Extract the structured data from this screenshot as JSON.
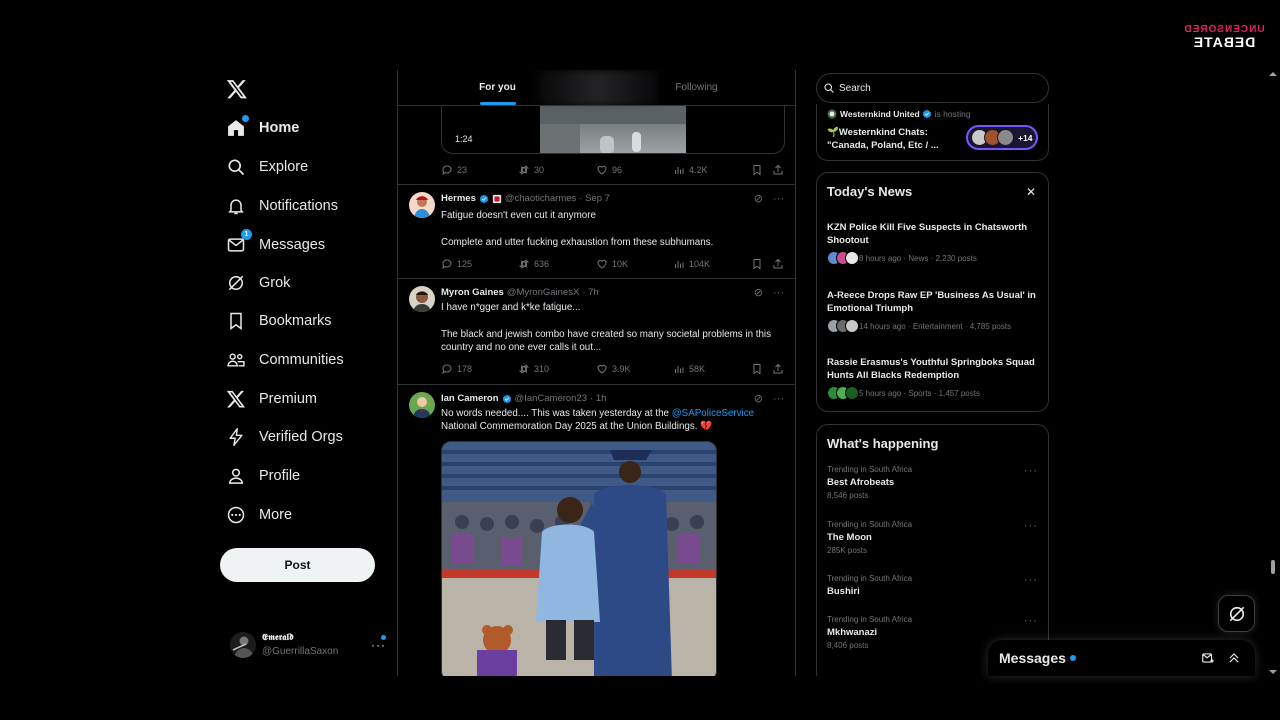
{
  "watermark": {
    "line1": "UNCENSORED",
    "line2": "DEBATE"
  },
  "nav": {
    "items": [
      {
        "label": "Home",
        "icon": "home-icon"
      },
      {
        "label": "Explore",
        "icon": "search-icon"
      },
      {
        "label": "Notifications",
        "icon": "bell-icon"
      },
      {
        "label": "Messages",
        "icon": "envelope-icon",
        "badge": "1"
      },
      {
        "label": "Grok",
        "icon": "grok-icon"
      },
      {
        "label": "Bookmarks",
        "icon": "bookmark-icon"
      },
      {
        "label": "Communities",
        "icon": "communities-icon"
      },
      {
        "label": "Premium",
        "icon": "x-icon"
      },
      {
        "label": "Verified Orgs",
        "icon": "lightning-icon"
      },
      {
        "label": "Profile",
        "icon": "person-icon"
      },
      {
        "label": "More",
        "icon": "more-circle-icon"
      }
    ],
    "post_label": "Post"
  },
  "account": {
    "display_name": "𝕰𝖒𝖊𝖗𝖆𝖑𝖉",
    "handle": "@GuerrillaSaxon"
  },
  "feed": {
    "tabs": [
      {
        "label": "For you"
      },
      {
        "label": "Following"
      }
    ],
    "first": {
      "video_time": "1:24",
      "replies": "23",
      "reposts": "30",
      "likes": "96",
      "views": "4.2K"
    },
    "tweets": [
      {
        "name": "Hermes",
        "handle": "@chaoticharmes",
        "time": "· Sep 7",
        "lines": [
          "Fatigue doesn't even cut it anymore",
          "Complete and utter fucking exhaustion from these subhumans."
        ],
        "replies": "125",
        "reposts": "636",
        "likes": "10K",
        "views": "104K"
      },
      {
        "name": "Myron Gaines",
        "handle": "@MyronGainesX",
        "time": "· 7h",
        "lines": [
          "I have n*gger and k*ke fatigue...",
          "The black and jewish combo have created so many societal problems in this country and no one ever calls it out..."
        ],
        "replies": "178",
        "reposts": "310",
        "likes": "3.9K",
        "views": "58K"
      },
      {
        "name": "Ian Cameron",
        "handle": "@IanCameron23",
        "time": "· 1h",
        "text_a": "No words needed.... This was taken yesterday at the ",
        "mention": "@SAPoliceService",
        "text_b": " National Commemoration Day 2025 at the Union Buildings. ",
        "emoji": "💔"
      }
    ]
  },
  "search": {
    "placeholder": "Search"
  },
  "space": {
    "host": "Westernkind United",
    "host_sub": "is hosting",
    "title": "🌱Westernkind Chats: \"Canada, Poland, Etc / ...",
    "count": "+14"
  },
  "news": {
    "title": "Today's News",
    "items": [
      {
        "title": "KZN Police Kill Five Suspects in Chatsworth Shootout",
        "meta": "8 hours ago · News · 2,230 posts"
      },
      {
        "title": "A-Reece Drops Raw EP 'Business As Usual' in Emotional Triumph",
        "meta": "14 hours ago · Entertainment · 4,785 posts"
      },
      {
        "title": "Rassie Erasmus's Youthful Springboks Squad Hunts All Blacks Redemption",
        "meta": "5 hours ago · Sports · 1,457 posts"
      }
    ]
  },
  "happening": {
    "title": "What's happening",
    "items": [
      {
        "context": "Trending in South Africa",
        "topic": "Best Afrobeats",
        "posts": "8,546 posts"
      },
      {
        "context": "Trending in South Africa",
        "topic": "The Moon",
        "posts": "285K posts"
      },
      {
        "context": "Trending in South Africa",
        "topic": "Bushiri",
        "posts": ""
      },
      {
        "context": "Trending in South Africa",
        "topic": "Mkhwanazi",
        "posts": "8,406 posts"
      }
    ]
  },
  "messages_drawer": {
    "title": "Messages"
  },
  "colors": {
    "accent": "#1d9bf0",
    "background": "#000000",
    "border": "#2f3336",
    "muted": "#71767b",
    "text": "#e7e9ea",
    "space": "#7856ff"
  }
}
